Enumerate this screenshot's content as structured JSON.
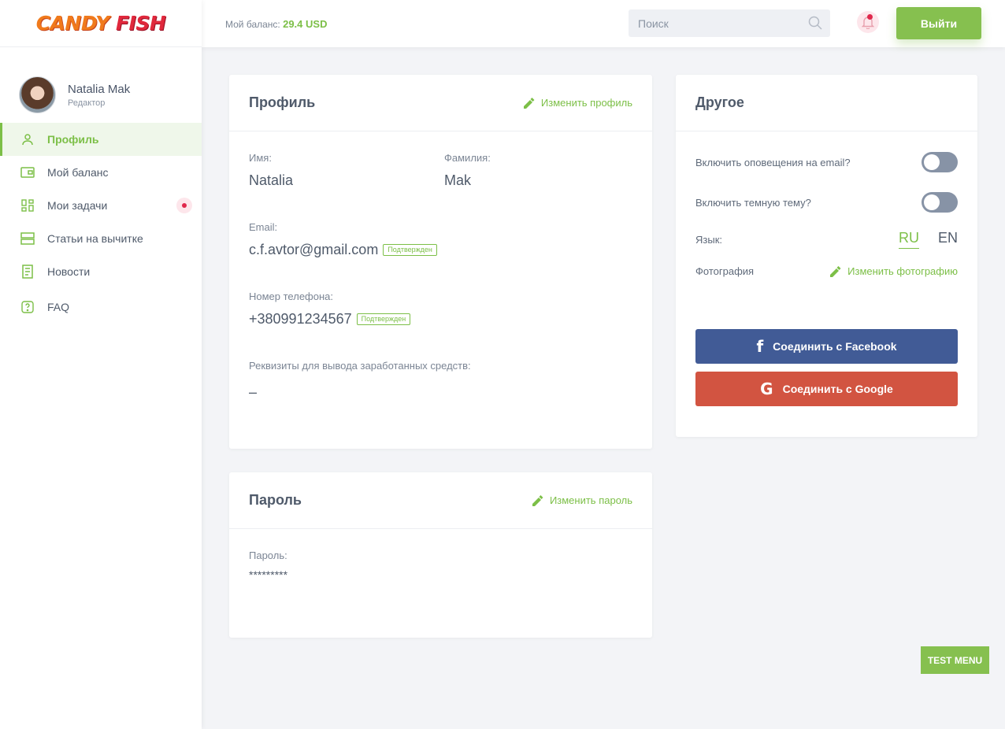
{
  "app": {
    "logo_part1": "Candy",
    "logo_part2": "Fish",
    "brand_color": "#86c04f"
  },
  "header": {
    "balance_label": "Мой баланс:",
    "balance_value": "29.4 USD",
    "search_placeholder": "Поиск",
    "logout_label": "Выйти"
  },
  "user": {
    "name": "Natalia Mak",
    "role": "Редактор"
  },
  "sidebar": {
    "items": [
      {
        "label": "Профиль",
        "icon": "user-icon",
        "active": true
      },
      {
        "label": "Мой баланс",
        "icon": "wallet-icon"
      },
      {
        "label": "Мои задачи",
        "icon": "grid-icon",
        "badge": true
      },
      {
        "label": "Статьи на вычитке",
        "icon": "server-icon"
      },
      {
        "label": "Новости",
        "icon": "document-icon"
      },
      {
        "label": "FAQ",
        "icon": "question-icon"
      }
    ]
  },
  "profile": {
    "title": "Профиль",
    "edit_label": "Изменить профиль",
    "first_name_label": "Имя:",
    "first_name": "Natalia",
    "last_name_label": "Фамилия:",
    "last_name": "Mak",
    "email_label": "Email:",
    "email": "c.f.avtor@gmail.com",
    "email_badge": "Подтвержден",
    "phone_label": "Номер телефона:",
    "phone": "+380991234567",
    "phone_badge": "Подтвержден",
    "requisites_label": "Реквизиты для вывода заработанных средств:",
    "requisites": "–"
  },
  "password": {
    "title": "Пароль",
    "edit_label": "Изменить пароль",
    "label": "Пароль:",
    "value": "*********"
  },
  "other": {
    "title": "Другое",
    "email_notify_label": "Включить оповещения на email?",
    "dark_theme_label": "Включить темную тему?",
    "language_label": "Язык:",
    "lang_ru": "RU",
    "lang_en": "EN",
    "photo_label": "Фотография",
    "photo_edit_label": "Изменить фотографию",
    "facebook_label": "Соединить с Facebook",
    "google_label": "Соединить с Google"
  },
  "test_menu_label": "TEST MENU"
}
